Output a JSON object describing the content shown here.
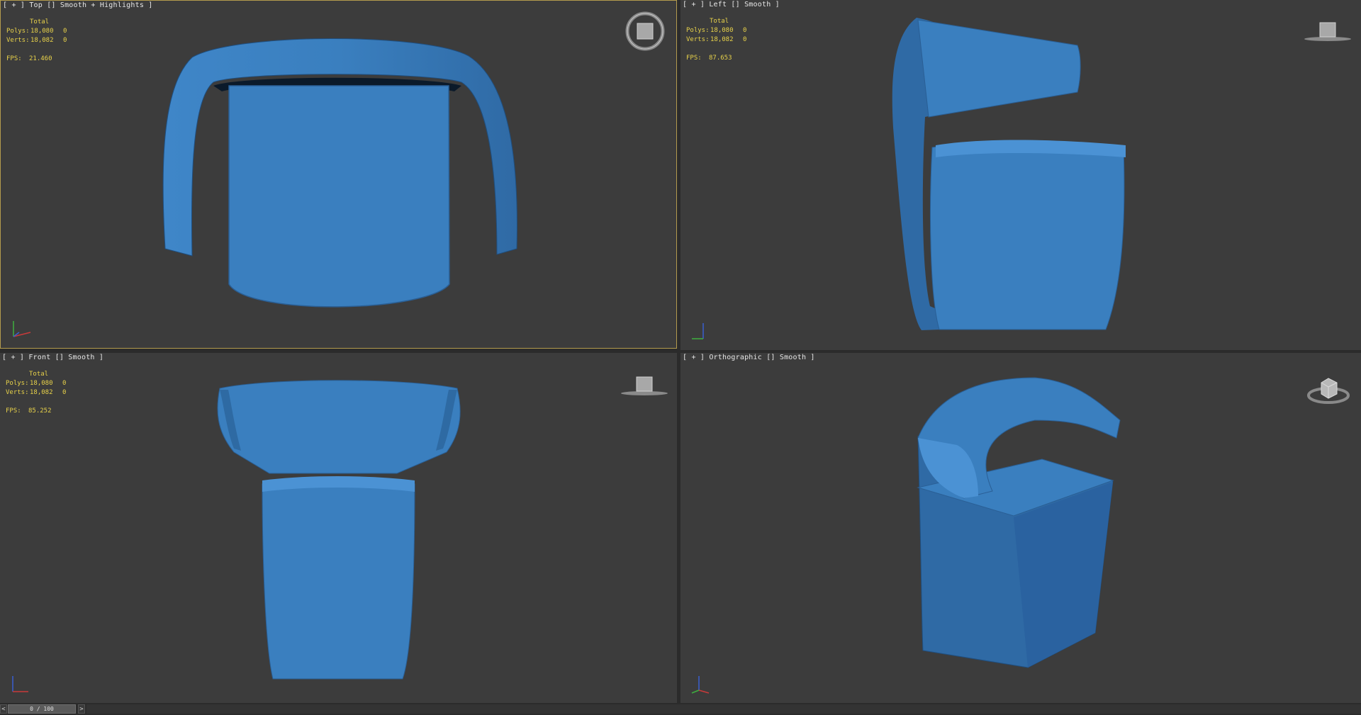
{
  "viewports": [
    {
      "id": "top",
      "label": "[ + ] Top [] Smooth + Highlights ]",
      "stats": {
        "header": "Total",
        "polys_label": "Polys:",
        "polys_total": "18,080",
        "polys_sel": "0",
        "verts_label": "Verts:",
        "verts_total": "18,082",
        "verts_sel": "0",
        "fps_label": "FPS:",
        "fps_value": "21.460"
      },
      "gizmo_text": "TOP"
    },
    {
      "id": "left",
      "label": "[ + ] Left [] Smooth ]",
      "stats": {
        "header": "Total",
        "polys_label": "Polys:",
        "polys_total": "18,080",
        "polys_sel": "0",
        "verts_label": "Verts:",
        "verts_total": "18,082",
        "verts_sel": "0",
        "fps_label": "FPS:",
        "fps_value": "87.653"
      },
      "gizmo_text": "LEFT"
    },
    {
      "id": "front",
      "label": "[ + ] Front [] Smooth ]",
      "stats": {
        "header": "Total",
        "polys_label": "Polys:",
        "polys_total": "18,080",
        "polys_sel": "0",
        "verts_label": "Verts:",
        "verts_total": "18,082",
        "verts_sel": "0",
        "fps_label": "FPS:",
        "fps_value": "85.252"
      },
      "gizmo_text": "FRONT"
    },
    {
      "id": "perspective",
      "label": "[ + ] Orthographic [] Smooth ]",
      "stats": null,
      "gizmo_text": ""
    }
  ],
  "timeline": {
    "frame": "0 / 100",
    "prev": "<",
    "next": ">"
  },
  "colors": {
    "viewport_bg": "#3c3c3c",
    "active_border": "#b39b4d",
    "model": "#3a7fbf",
    "stats_text": "#e8d24a",
    "label_text": "#e6e6e6"
  },
  "icons": [
    "viewcube-icon",
    "axis-tripod-icon"
  ]
}
